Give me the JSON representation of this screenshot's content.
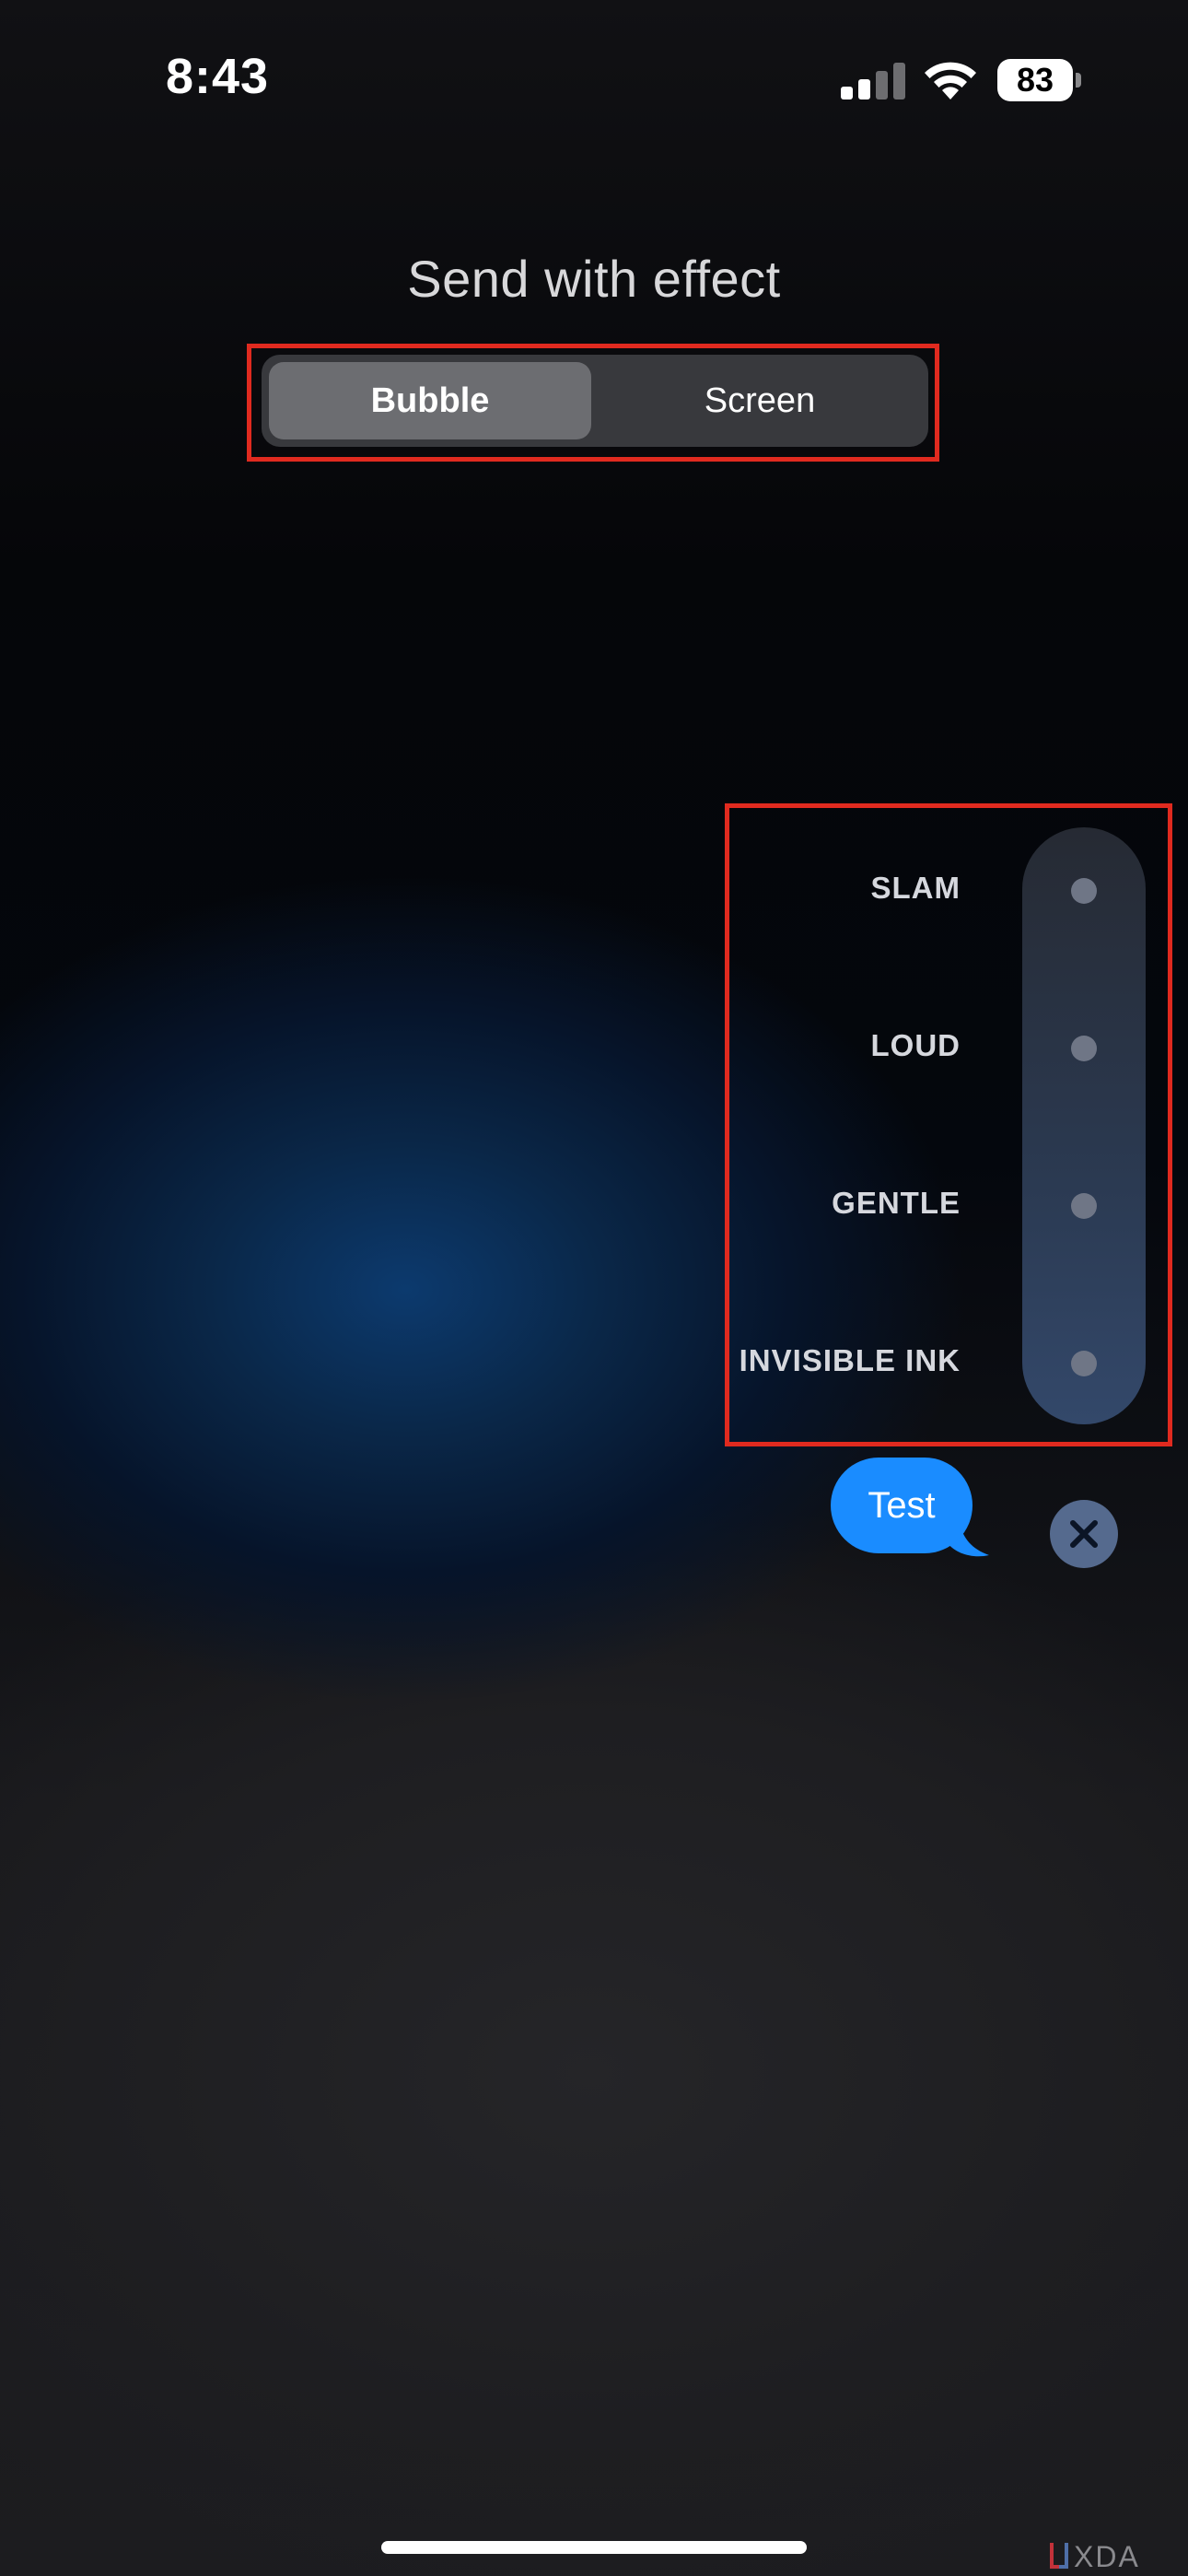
{
  "status_bar": {
    "time": "8:43",
    "battery_level": "83",
    "signal_bars_active": 2,
    "signal_bars_total": 4
  },
  "header": {
    "title": "Send with effect"
  },
  "segmented_control": {
    "options": [
      "Bubble",
      "Screen"
    ],
    "selected": "Bubble"
  },
  "effects": [
    {
      "label": "SLAM"
    },
    {
      "label": "LOUD"
    },
    {
      "label": "GENTLE"
    },
    {
      "label": "INVISIBLE INK"
    }
  ],
  "message": {
    "text": "Test",
    "bubble_color": "#1a8cff"
  },
  "close_button": {
    "icon": "close-icon"
  },
  "annotation_color": "#e02a1f",
  "watermark": {
    "text": "XDA"
  }
}
